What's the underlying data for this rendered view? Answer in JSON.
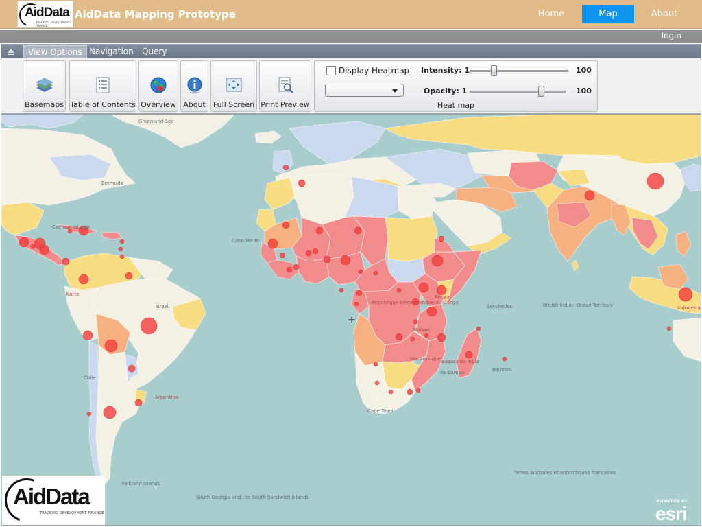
{
  "header": {
    "logo_text": "AidData",
    "logo_tagline": "TRACKING DEVELOPMENT FINANCE",
    "title": "AidData Mapping Prototype",
    "nav": [
      {
        "label": "Home",
        "active": false
      },
      {
        "label": "Map",
        "active": true
      },
      {
        "label": "About",
        "active": false
      }
    ],
    "login_label": "login",
    "colors": {
      "banner": "#e1bc89",
      "active_tab": "#0f93f0",
      "strip": "#8f8f8f"
    }
  },
  "toolbar": {
    "tabs": [
      {
        "label": "View Options",
        "active": true
      },
      {
        "label": "Navigation",
        "active": false
      },
      {
        "label": "Query",
        "active": false
      }
    ],
    "buttons": [
      {
        "label": "Basemaps",
        "icon": "basemaps-icon"
      },
      {
        "label": "Table of Contents",
        "icon": "table-of-contents-icon"
      },
      {
        "label": "Overview",
        "icon": "globe-icon"
      },
      {
        "label": "About",
        "icon": "info-icon"
      },
      {
        "label": "Full Screen",
        "icon": "full-screen-icon"
      },
      {
        "label": "Print Preview",
        "icon": "print-preview-icon"
      }
    ],
    "heatmap": {
      "group_label": "Heat map",
      "checkbox_label": "Display Heatmap",
      "checked": false,
      "select_value": "",
      "intensity": {
        "label": "Intensity: 1",
        "max_label": "100",
        "value_fraction": 0.25
      },
      "opacity": {
        "label": "Opacity: 1",
        "max_label": "100",
        "value_fraction": 0.75
      }
    }
  },
  "map": {
    "logo_text": "AidData",
    "logo_tagline": "TRACKING DEVELOPMENT FINANCE",
    "esri_powered": "POWERED BY",
    "esri_name": "esri",
    "colors": {
      "ocean": "#a9cccd",
      "high": "#f28c8c",
      "medium": "#f7b07f",
      "low": "#f8dc82",
      "none": "#f4f1e4",
      "no_data": "#cbd9ef"
    },
    "labels": {
      "greenland": "Greenland Sea",
      "bermuda": "Bermuda",
      "cayman": "Cayman Islands",
      "cabo_verde": "Cabo Verde",
      "norte": "Norte",
      "congo": "Republique Democratique du Congo",
      "mozambique": "Mocambique",
      "malawi": "Malawi",
      "bassas": "Bassas da India",
      "ile": "Ile Europa",
      "cape_town": "Cape Town",
      "reunion": "Reunion",
      "seychelles": "Seychelles",
      "british": "British Indian Ocean Territory",
      "indonesia": "Indonesia",
      "terres": "Terres australes et antarctiques francaises",
      "south_georgia": "South Georgia and the South Sandwich Islands",
      "falkland": "Falkland Islands",
      "argentina": "Argentina",
      "kenya": "Kenya",
      "chile": "Chile",
      "brasil": "Brasil"
    }
  }
}
